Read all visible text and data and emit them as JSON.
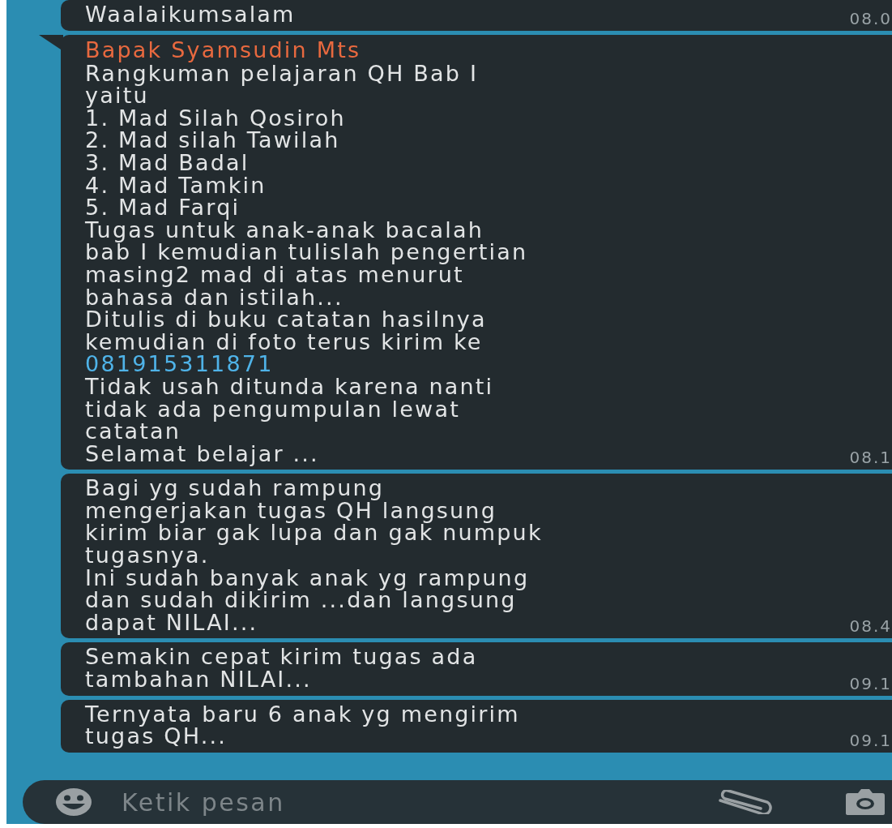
{
  "messages": [
    {
      "lines": [
        {
          "kind": "text",
          "text": "Waalaikumsalam"
        }
      ],
      "time": "08.0",
      "tail": false
    },
    {
      "sender": "Bapak Syamsudin Mts",
      "tail": true,
      "time": "08.1",
      "lines": [
        {
          "kind": "text",
          "text": "Rangkuman pelajaran QH Bab I"
        },
        {
          "kind": "text",
          "text": "yaitu"
        },
        {
          "kind": "text",
          "text": "1. Mad Silah Qosiroh"
        },
        {
          "kind": "text",
          "text": "2. Mad silah Tawilah"
        },
        {
          "kind": "text",
          "text": "3. Mad Badal"
        },
        {
          "kind": "text",
          "text": "4. Mad Tamkin"
        },
        {
          "kind": "text",
          "text": "5. Mad Farqi"
        },
        {
          "kind": "text",
          "text": "Tugas untuk anak-anak bacalah"
        },
        {
          "kind": "text",
          "text": "bab I kemudian tulislah pengertian"
        },
        {
          "kind": "text",
          "text": "masing2 mad di atas menurut"
        },
        {
          "kind": "text",
          "text": "bahasa dan istilah..."
        },
        {
          "kind": "text",
          "text": "Ditulis di buku catatan hasilnya"
        },
        {
          "kind": "text",
          "text": "kemudian di foto terus kirim ke"
        },
        {
          "kind": "link",
          "text": "081915311871"
        },
        {
          "kind": "text",
          "text": "Tidak usah ditunda karena nanti"
        },
        {
          "kind": "text",
          "text": "tidak ada pengumpulan lewat"
        },
        {
          "kind": "text",
          "text": "catatan"
        },
        {
          "kind": "text",
          "text": "Selamat belajar ..."
        }
      ]
    },
    {
      "tail": false,
      "time": "08.4",
      "lines": [
        {
          "kind": "text",
          "text": "Bagi yg sudah rampung"
        },
        {
          "kind": "text",
          "text": "mengerjakan tugas QH langsung"
        },
        {
          "kind": "text",
          "text": "kirim biar gak lupa dan gak numpuk"
        },
        {
          "kind": "text",
          "text": "tugasnya."
        },
        {
          "kind": "text",
          "text": "Ini sudah banyak anak yg rampung"
        },
        {
          "kind": "text",
          "text": "dan sudah dikirim ...dan langsung"
        },
        {
          "kind": "text",
          "text": "dapat NILAI..."
        }
      ]
    },
    {
      "tail": false,
      "time": "09.1",
      "lines": [
        {
          "kind": "text",
          "text": "Semakin cepat kirim tugas ada"
        },
        {
          "kind": "text",
          "text": "tambahan NILAI..."
        }
      ]
    },
    {
      "tail": false,
      "time": "09.1",
      "lines": [
        {
          "kind": "text",
          "text": "Ternyata baru 6 anak yg mengirim"
        },
        {
          "kind": "text",
          "text": "tugas QH..."
        }
      ]
    }
  ],
  "composer": {
    "placeholder": "Ketik pesan"
  }
}
